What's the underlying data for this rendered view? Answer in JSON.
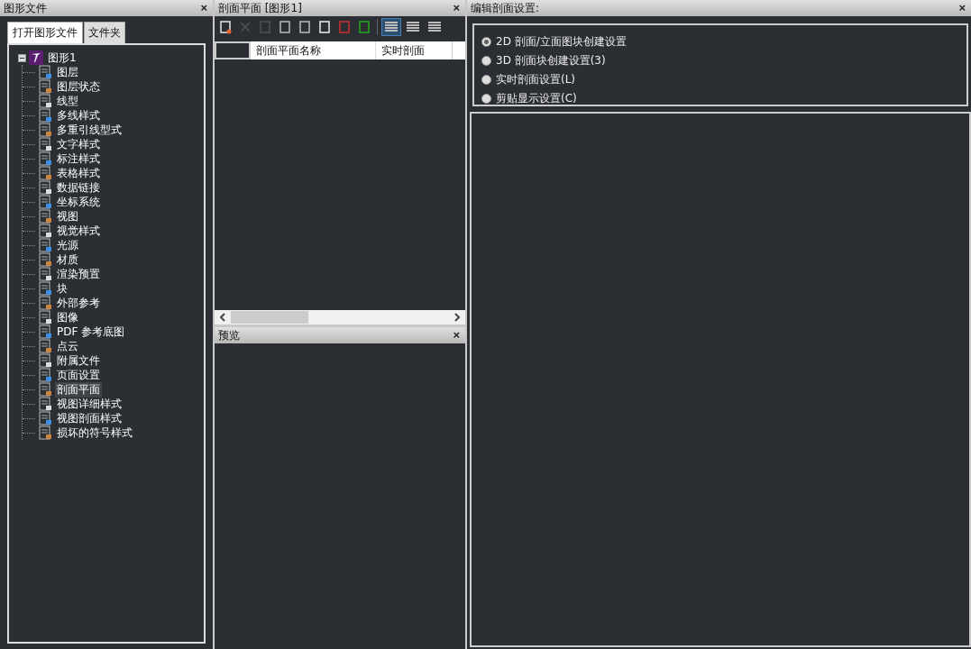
{
  "drawings_panel": {
    "title": "图形文件",
    "close": "×",
    "tabs": [
      {
        "label": "打开图形文件",
        "selected": true
      },
      {
        "label": "文件夹",
        "selected": false
      }
    ],
    "tree": [
      {
        "label": "图形1",
        "expanded": true,
        "selected": false,
        "children": [
          {
            "label": "图层",
            "selected": false
          },
          {
            "label": "图层状态",
            "selected": false
          },
          {
            "label": "线型",
            "selected": false
          },
          {
            "label": "多线样式",
            "selected": false
          },
          {
            "label": "多重引线型式",
            "selected": false
          },
          {
            "label": "文字样式",
            "selected": false
          },
          {
            "label": "标注样式",
            "selected": false
          },
          {
            "label": "表格样式",
            "selected": false
          },
          {
            "label": "数据链接",
            "selected": false
          },
          {
            "label": "坐标系统",
            "selected": false
          },
          {
            "label": "视图",
            "selected": false
          },
          {
            "label": "视觉样式",
            "selected": false
          },
          {
            "label": "光源",
            "selected": false
          },
          {
            "label": "材质",
            "selected": false
          },
          {
            "label": "渲染预置",
            "selected": false
          },
          {
            "label": "块",
            "selected": false
          },
          {
            "label": "外部参考",
            "selected": false
          },
          {
            "label": "图像",
            "selected": false
          },
          {
            "label": "PDF 参考底图",
            "selected": false
          },
          {
            "label": "点云",
            "selected": false
          },
          {
            "label": "附属文件",
            "selected": false
          },
          {
            "label": "页面设置",
            "selected": false
          },
          {
            "label": "剖面平面",
            "selected": true
          },
          {
            "label": "视图详细样式",
            "selected": false
          },
          {
            "label": "视图剖面样式",
            "selected": false
          },
          {
            "label": "损坏的符号样式",
            "selected": false
          }
        ]
      }
    ]
  },
  "section_planes_panel": {
    "title": "剖面平面 [图形1]",
    "close": "×",
    "toolbar": [
      {
        "disabled": false
      },
      {
        "disabled": true
      },
      {
        "disabled": true
      },
      {
        "disabled": false
      },
      {
        "disabled": false
      },
      {
        "disabled": false
      },
      {
        "disabled": false
      },
      {
        "disabled": false
      }
    ],
    "view_buttons": [
      {
        "selected": true
      },
      {
        "selected": false
      },
      {
        "selected": false
      }
    ],
    "columns": [
      "剖面平面名称",
      "实时剖面"
    ]
  },
  "preview_panel": {
    "title": "预览",
    "close": "×"
  },
  "edit_panel": {
    "title": "编辑剖面设置:",
    "close": "×",
    "options": [
      {
        "label": "2D 剖面/立面图块创建设置",
        "selected": true
      },
      {
        "label": "3D 剖面块创建设置(3)",
        "selected": false
      },
      {
        "label": "实时剖面设置(L)",
        "selected": false
      },
      {
        "label": "剪贴显示设置(C)",
        "selected": false
      }
    ]
  }
}
